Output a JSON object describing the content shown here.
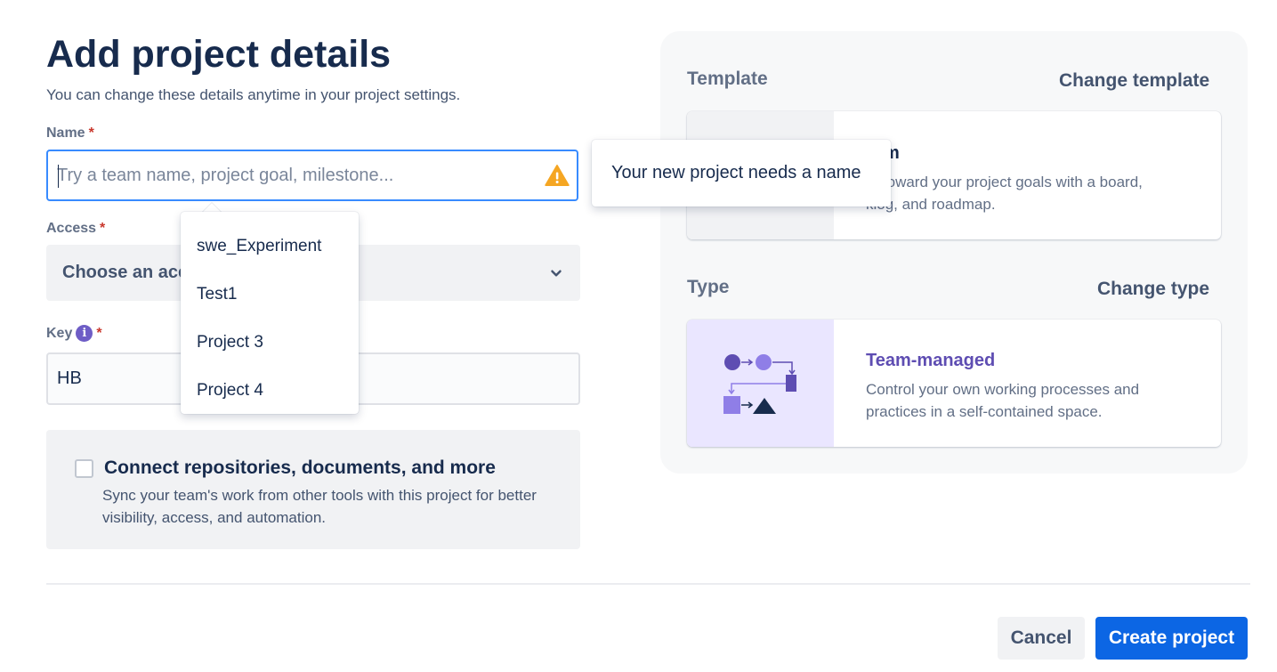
{
  "form": {
    "title": "Add project details",
    "subtitle": "You can change these details anytime in your project settings.",
    "name_label": "Name",
    "name_placeholder": "Try a team name, project goal, milestone...",
    "name_value": "",
    "required_mark": "*",
    "access_label": "Access",
    "access_value": "Choose an acc",
    "key_label": "Key",
    "key_value": "HB",
    "connect_title": "Connect repositories, documents, and more",
    "connect_desc": "Sync your team's work from other tools with this project for better visibility, access, and automation.",
    "connect_checked": false
  },
  "suggestions": {
    "items": [
      {
        "label": "swe_Experiment"
      },
      {
        "label": "Test1"
      },
      {
        "label": "Project 3"
      },
      {
        "label": "Project 4"
      }
    ]
  },
  "tooltip": {
    "text": "Your new project needs a name"
  },
  "template": {
    "label": "Template",
    "change_link": "Change template",
    "title_visible": "rum",
    "desc_line1": "nt toward your project goals with a board,",
    "desc_line2": "klog, and roadmap."
  },
  "type": {
    "label": "Type",
    "change_link": "Change type",
    "title": "Team-managed",
    "desc": "Control your own working processes and practices in a self-contained space."
  },
  "footer": {
    "cancel_label": "Cancel",
    "create_label": "Create project"
  },
  "colors": {
    "primary": "#0c66e4",
    "focus_border": "#388bff",
    "warning": "#f5a623",
    "purple_accent": "#5e4db2",
    "required": "#c9372c"
  },
  "icons": {
    "warning": "warning-icon",
    "chevron": "chevron-down-icon",
    "info": "info-icon"
  }
}
